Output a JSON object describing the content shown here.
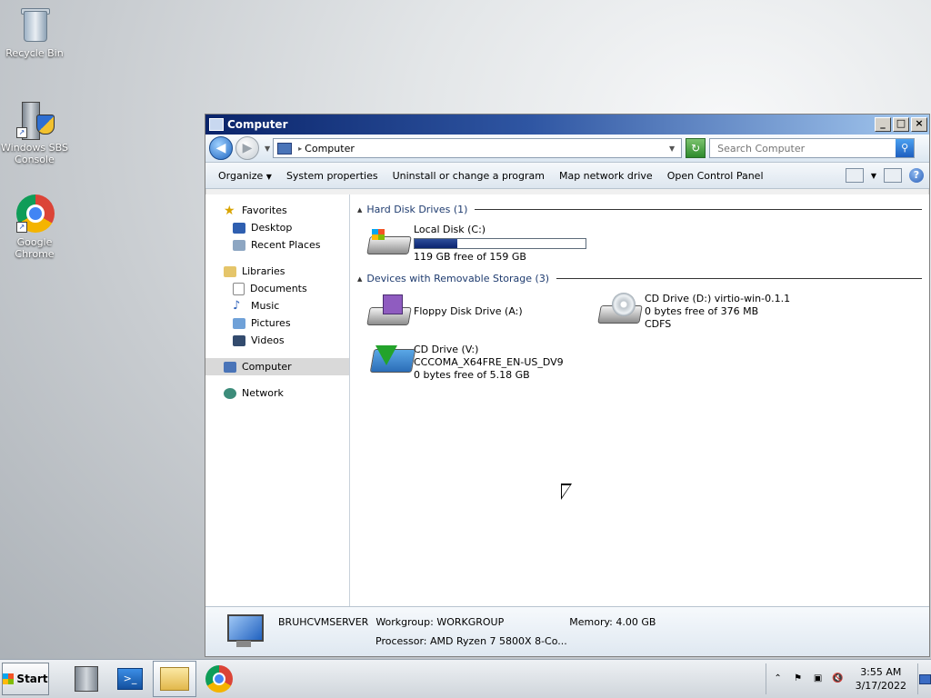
{
  "desktop": {
    "icons": [
      {
        "label": "Recycle Bin",
        "icon": "recycle-bin-icon"
      },
      {
        "label": "Windows SBS Console",
        "icon": "sbs-console-icon"
      },
      {
        "label": "Google Chrome",
        "icon": "chrome-icon"
      }
    ]
  },
  "window": {
    "title": "Computer",
    "buttons": {
      "minimize": "_",
      "maximize": "□",
      "close": "×"
    },
    "address": {
      "location": "Computer"
    },
    "search": {
      "placeholder": "Search Computer"
    },
    "toolbar": {
      "items": [
        "Organize",
        "System properties",
        "Uninstall or change a program",
        "Map network drive",
        "Open Control Panel"
      ],
      "organize_arrow": "▼",
      "help": "?"
    },
    "nav": {
      "favorites": "Favorites",
      "favorite_items": [
        "Desktop",
        "Recent Places"
      ],
      "libraries": "Libraries",
      "library_items": [
        "Documents",
        "Music",
        "Pictures",
        "Videos"
      ],
      "computer": "Computer",
      "network": "Network"
    },
    "groups": {
      "hard_disks": "Hard Disk Drives (1)",
      "removable": "Devices with Removable Storage (3)"
    },
    "drives": {
      "c": {
        "name": "Local Disk (C:)",
        "free": "119 GB free of 159 GB",
        "used_fraction": 0.25
      },
      "a": {
        "name": "Floppy Disk Drive (A:)"
      },
      "d": {
        "name": "CD Drive (D:) virtio-win-0.1.1",
        "free": "0 bytes free of 376 MB",
        "fs": "CDFS"
      },
      "v": {
        "name": "CD Drive (V:)",
        "label": "CCCOMA_X64FRE_EN-US_DV9",
        "free": "0 bytes free of 5.18 GB"
      }
    },
    "details": {
      "computer_name": "BRUHCVMSERVER",
      "workgroup_label": "Workgroup:",
      "workgroup": "WORKGROUP",
      "memory_label": "Memory:",
      "memory": "4.00 GB",
      "processor_label": "Processor:",
      "processor": "AMD Ryzen 7 5800X 8-Co..."
    }
  },
  "taskbar": {
    "start_label": "Start",
    "apps": [
      "server-manager-icon",
      "powershell-icon",
      "explorer-icon",
      "chrome-icon"
    ],
    "tray": {
      "chevron": "⌃",
      "flag": "⚑",
      "network": "▣",
      "volume": "🔇"
    },
    "clock": {
      "time": "3:55 AM",
      "date": "3/17/2022"
    }
  }
}
